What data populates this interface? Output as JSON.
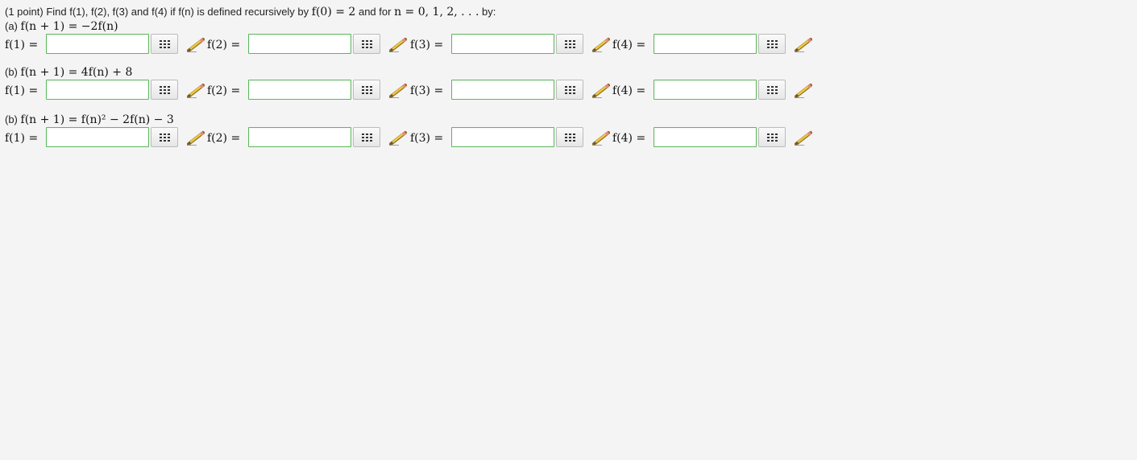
{
  "problem": {
    "points": "(1 point)",
    "intro_text": "Find f(1), f(2), f(3) and f(4) if f(n) is defined recursively by",
    "base_case": "f(0) = 2",
    "and_for": "and for",
    "n_range": "n = 0, 1, 2, . . .",
    "by": "by:"
  },
  "parts": [
    {
      "label": "(a)",
      "formula": "f(n + 1) = −2f(n)",
      "answers": [
        {
          "label": "f(1) =",
          "value": ""
        },
        {
          "label": "f(2) =",
          "value": ""
        },
        {
          "label": "f(3) =",
          "value": ""
        },
        {
          "label": "f(4) =",
          "value": ""
        }
      ]
    },
    {
      "label": "(b)",
      "formula": "f(n + 1) = 4f(n) + 8",
      "answers": [
        {
          "label": "f(1) =",
          "value": ""
        },
        {
          "label": "f(2) =",
          "value": ""
        },
        {
          "label": "f(3) =",
          "value": ""
        },
        {
          "label": "f(4) =",
          "value": ""
        }
      ]
    },
    {
      "label": "(b)",
      "formula": "f(n + 1) = f(n)² − 2f(n) − 3",
      "answers": [
        {
          "label": "f(1) =",
          "value": ""
        },
        {
          "label": "f(2) =",
          "value": ""
        },
        {
          "label": "f(3) =",
          "value": ""
        },
        {
          "label": "f(4) =",
          "value": ""
        }
      ]
    }
  ],
  "icons": {
    "palette": "equation-palette-icon",
    "pencil": "pencil-icon"
  },
  "colors": {
    "field_border": "#5cb85c",
    "background": "#f4f4f4"
  }
}
